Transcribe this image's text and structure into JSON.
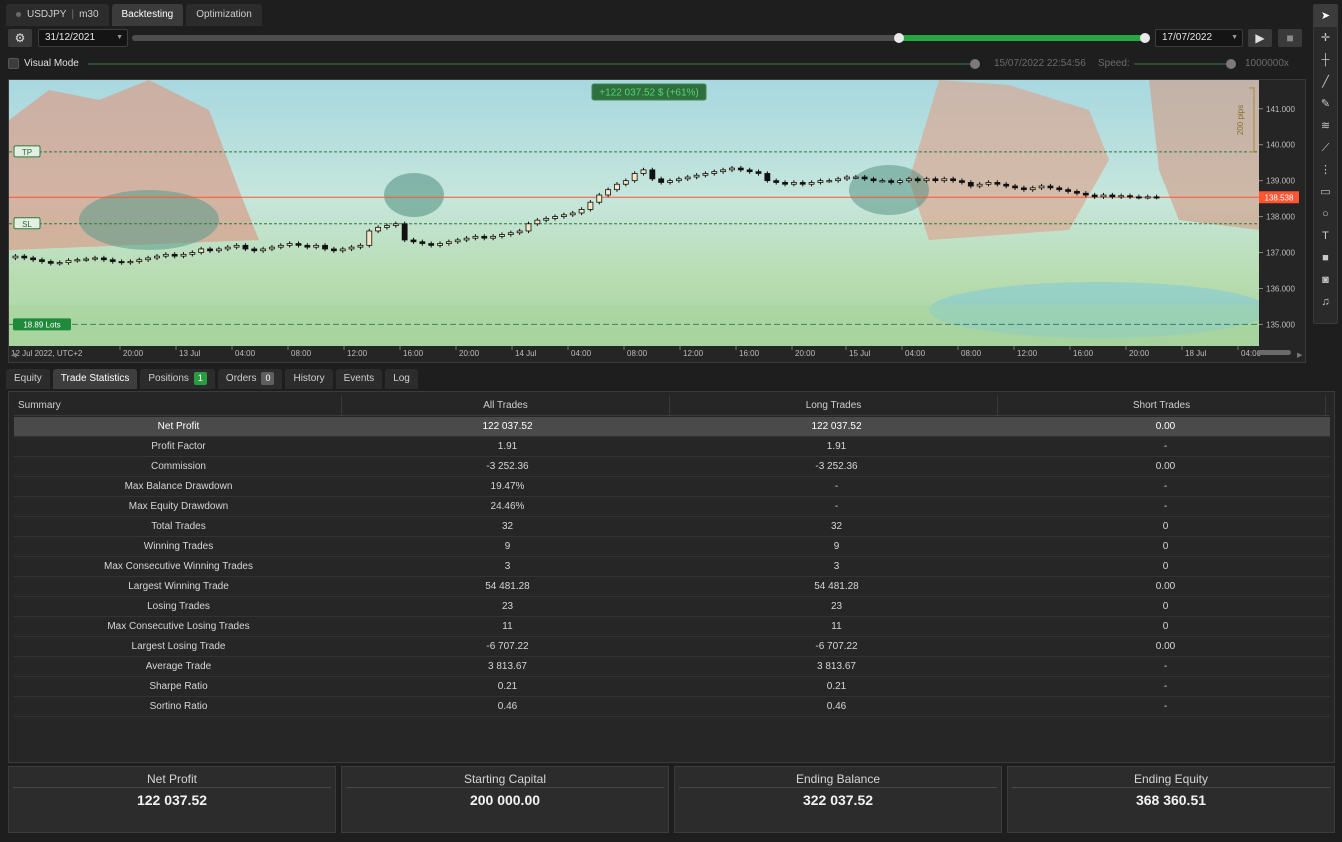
{
  "top_tabs": {
    "symbol": "USDJPY",
    "timeframe": "m30",
    "backtesting": "Backtesting",
    "optimization": "Optimization"
  },
  "controls": {
    "start_date": "31/12/2021",
    "end_date": "17/07/2022",
    "range_fill_fraction": {
      "from": 0.0,
      "knob_a": 0.75,
      "knob_b": 1.0
    }
  },
  "visual": {
    "label": "Visual Mode",
    "timestamp": "15/07/2022 22:54:56",
    "speed_label": "Speed:",
    "speed_value": "1000000x"
  },
  "chart": {
    "profit_label": "+122 037.52 $ (+61%)",
    "tp_label": "TP",
    "sl_label": "SL",
    "lots_label": "18.89 Lots",
    "pips_label": "200 pips",
    "current_price": "138.538",
    "price_ticks": [
      "141.000",
      "140.000",
      "139.000",
      "138.000",
      "137.000",
      "136.000",
      "135.000"
    ],
    "time_ticks": [
      "12 Jul 2022, UTC+2",
      "20:00",
      "13 Jul",
      "04:00",
      "08:00",
      "12:00",
      "16:00",
      "20:00",
      "14 Jul",
      "04:00",
      "08:00",
      "12:00",
      "16:00",
      "20:00",
      "15 Jul",
      "04:00",
      "08:00",
      "12:00",
      "16:00",
      "20:00",
      "18 Jul",
      "04:00"
    ],
    "colors": {
      "bull": "#f4e7c5",
      "bear": "#111111",
      "current_line": "#ff5533",
      "tp_line": "#2a7a3a",
      "profit_badge": "#2f6f3f"
    },
    "price_levels": {
      "tp": 139.8,
      "sl": 137.8,
      "current": 138.538,
      "lots": 135.0
    },
    "closes": [
      136.9,
      136.85,
      136.8,
      136.75,
      136.7,
      136.72,
      136.78,
      136.8,
      136.82,
      136.85,
      136.8,
      136.75,
      136.72,
      136.75,
      136.8,
      136.85,
      136.9,
      136.95,
      136.9,
      136.95,
      137.0,
      137.1,
      137.05,
      137.1,
      137.15,
      137.2,
      137.1,
      137.05,
      137.1,
      137.15,
      137.2,
      137.25,
      137.2,
      137.15,
      137.2,
      137.1,
      137.05,
      137.1,
      137.15,
      137.2,
      137.6,
      137.7,
      137.75,
      137.8,
      137.35,
      137.3,
      137.25,
      137.2,
      137.25,
      137.3,
      137.35,
      137.4,
      137.45,
      137.4,
      137.45,
      137.5,
      137.55,
      137.6,
      137.8,
      137.9,
      137.95,
      138.0,
      138.05,
      138.1,
      138.2,
      138.4,
      138.6,
      138.75,
      138.9,
      139.0,
      139.2,
      139.3,
      139.05,
      138.95,
      139.0,
      139.05,
      139.1,
      139.15,
      139.2,
      139.25,
      139.3,
      139.35,
      139.3,
      139.25,
      139.2,
      139.0,
      138.95,
      138.9,
      138.95,
      138.9,
      138.95,
      139.0,
      139.0,
      139.05,
      139.1,
      139.1,
      139.05,
      139.0,
      139.0,
      138.95,
      139.0,
      139.05,
      139.0,
      139.05,
      139.0,
      139.05,
      139.0,
      138.95,
      138.85,
      138.9,
      138.95,
      138.9,
      138.85,
      138.8,
      138.75,
      138.8,
      138.85,
      138.8,
      138.75,
      138.7,
      138.65,
      138.6,
      138.55,
      138.6,
      138.55,
      138.58,
      138.55,
      138.54,
      138.55,
      138.54
    ]
  },
  "tool_icons": [
    "cursor-icon",
    "crosshair-icon",
    "cross-icon",
    "line-icon",
    "pencil-icon",
    "fib-icon",
    "ray-icon",
    "grid-icon",
    "rect-icon",
    "ellipse-icon",
    "text-icon",
    "square-icon",
    "camera-icon",
    "bell-icon"
  ],
  "bottom_tabs": {
    "equity": "Equity",
    "trade_statistics": "Trade Statistics",
    "positions": "Positions",
    "positions_count": "1",
    "orders": "Orders",
    "orders_count": "0",
    "history": "History",
    "events": "Events",
    "log": "Log"
  },
  "stats": {
    "headers": [
      "Summary",
      "All Trades",
      "Long Trades",
      "Short Trades"
    ],
    "rows": [
      [
        "Net Profit",
        "122 037.52",
        "122 037.52",
        "0.00"
      ],
      [
        "Profit Factor",
        "1.91",
        "1.91",
        "-"
      ],
      [
        "Commission",
        "-3 252.36",
        "-3 252.36",
        "0.00"
      ],
      [
        "Max Balance Drawdown",
        "19.47%",
        "-",
        "-"
      ],
      [
        "Max Equity Drawdown",
        "24.46%",
        "-",
        "-"
      ],
      [
        "Total Trades",
        "32",
        "32",
        "0"
      ],
      [
        "Winning Trades",
        "9",
        "9",
        "0"
      ],
      [
        "Max Consecutive Winning Trades",
        "3",
        "3",
        "0"
      ],
      [
        "Largest Winning Trade",
        "54 481.28",
        "54 481.28",
        "0.00"
      ],
      [
        "Losing Trades",
        "23",
        "23",
        "0"
      ],
      [
        "Max Consecutive Losing Trades",
        "11",
        "11",
        "0"
      ],
      [
        "Largest Losing Trade",
        "-6 707.22",
        "-6 707.22",
        "0.00"
      ],
      [
        "Average Trade",
        "3 813.67",
        "3 813.67",
        "-"
      ],
      [
        "Sharpe Ratio",
        "0.21",
        "0.21",
        "-"
      ],
      [
        "Sortino Ratio",
        "0.46",
        "0.46",
        "-"
      ]
    ]
  },
  "summary": [
    {
      "title": "Net Profit",
      "value": "122 037.52"
    },
    {
      "title": "Starting Capital",
      "value": "200 000.00"
    },
    {
      "title": "Ending Balance",
      "value": "322 037.52"
    },
    {
      "title": "Ending Equity",
      "value": "368 360.51"
    }
  ]
}
